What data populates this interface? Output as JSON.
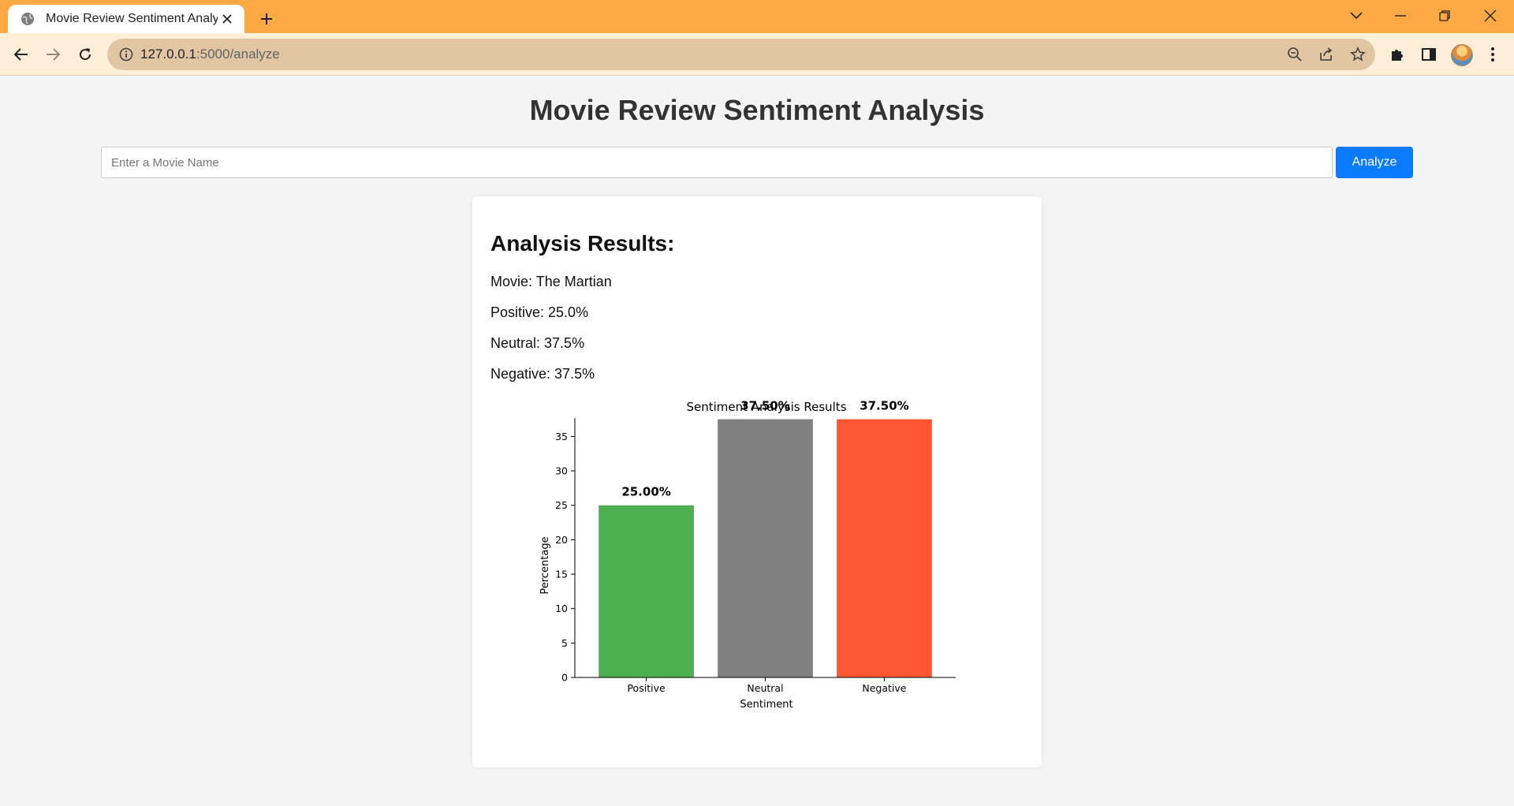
{
  "browser": {
    "tab_title": "Movie Review Sentiment Analysi",
    "url_host": "127.0.0.1",
    "url_path": ":5000/analyze",
    "icons": [
      "globe-icon",
      "close-icon",
      "plus-icon",
      "chevron-down-icon",
      "minimize-icon",
      "restore-icon",
      "close-window-icon",
      "back-icon",
      "forward-icon",
      "reload-icon",
      "info-icon",
      "zoom-out-icon",
      "share-icon",
      "star-icon",
      "puzzle-icon",
      "side-panel-icon",
      "avatar",
      "kebab-menu-icon"
    ],
    "colors": {
      "titlebar": "#ffa944",
      "toolbar": "#ffefd9",
      "omnibox": "#e2c6a4"
    }
  },
  "page": {
    "title": "Movie Review Sentiment Analysis",
    "search": {
      "placeholder": "Enter a Movie Name",
      "value": ""
    },
    "analyze_button": "Analyze",
    "accent_color": "#0a7bff"
  },
  "results": {
    "heading": "Analysis Results:",
    "lines": [
      {
        "label": "Movie: ",
        "value": "The Martian"
      },
      {
        "label": "Positive: ",
        "value": "25.0%"
      },
      {
        "label": "Neutral: ",
        "value": "37.5%"
      },
      {
        "label": "Negative: ",
        "value": "37.5%"
      }
    ]
  },
  "chart_data": {
    "type": "bar",
    "title": "Sentiment Analysis Results",
    "xlabel": "Sentiment",
    "ylabel": "Percentage",
    "categories": [
      "Positive",
      "Neutral",
      "Negative"
    ],
    "values": [
      25.0,
      37.5,
      37.5
    ],
    "data_labels": [
      "25.00%",
      "37.50%",
      "37.50%"
    ],
    "colors": [
      "#4caf50",
      "#808080",
      "#ff5733"
    ],
    "ylim": [
      0,
      39.4
    ],
    "yticks": [
      0,
      5,
      10,
      15,
      20,
      25,
      30,
      35
    ],
    "grid": false,
    "legend": "none"
  }
}
